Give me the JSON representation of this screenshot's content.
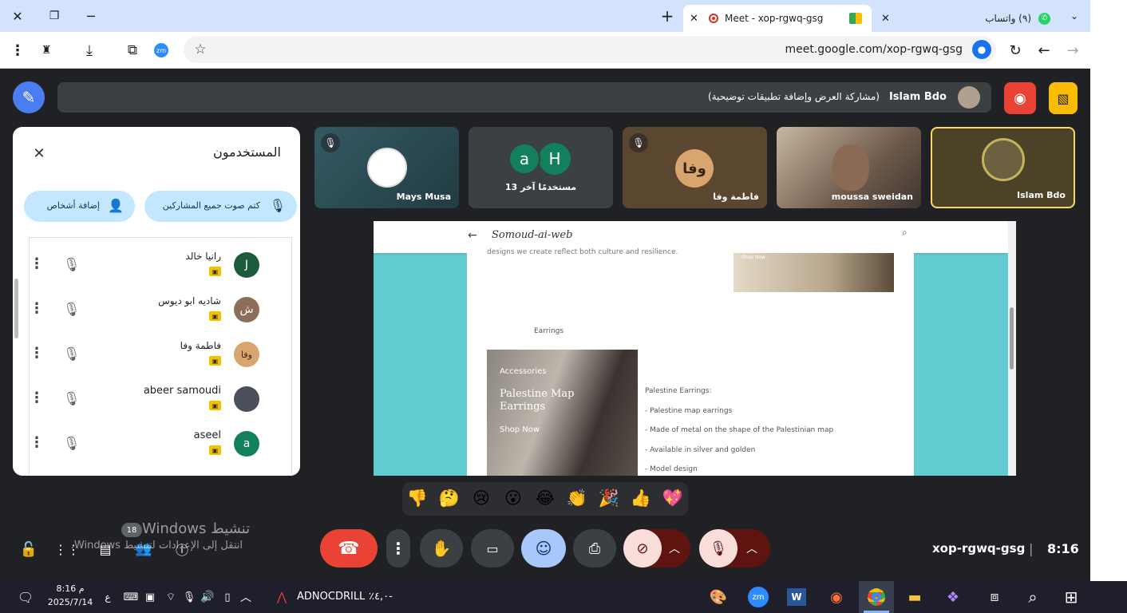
{
  "browser": {
    "tabs": [
      {
        "title": "Meet - xop-rgwq-gsg",
        "active": true
      },
      {
        "title": "(٩) واتساب",
        "active": false
      }
    ],
    "url": "meet.google.com/xop-rgwq-gsg"
  },
  "meet": {
    "presenter_bar": {
      "name": "Islam Bdo",
      "text": "(مشاركة العرض وإضافة تطبيقات توضيحية)"
    },
    "tiles": [
      {
        "name": "Islam Bdo",
        "muted": false,
        "highlight": true
      },
      {
        "name": "moussa sweidan",
        "muted": false
      },
      {
        "name": "فاطمة وفا",
        "muted": true,
        "avatar": "وفا"
      },
      {
        "name": "13 مستخدمًا آخر",
        "avatars": [
          "a",
          "H"
        ]
      },
      {
        "name": "Mays Musa",
        "muted": true
      }
    ],
    "panel": {
      "title": "المستخدمون",
      "mute_all": "كتم صوت جميع المشاركين",
      "add_people": "إضافة أشخاص",
      "participants": [
        {
          "name": "رانيا خالد",
          "initial": "J",
          "color": "#1e5a3c"
        },
        {
          "name": "شاديه ابو ديوس",
          "initial": "ش",
          "color": "#8d6e5a"
        },
        {
          "name": "فاطمة وفا",
          "initial": "وفا",
          "color": "#d9a56f"
        },
        {
          "name": "abeer samoudi",
          "initial": "",
          "color": "#4a4f59"
        },
        {
          "name": "aseel",
          "initial": "a",
          "color": "#12805c"
        }
      ]
    },
    "shared": {
      "site_title": "Somoud-ai-web",
      "snippet": "designs we create reflect both culture and resilience.",
      "shop_now_small": "Shop Now",
      "section": "Earrings",
      "img_tag": "Accessories",
      "img_title": "Palestine Map Earrings",
      "img_cta": "Shop Now",
      "details": [
        "Palestine Earrings:",
        "- Palestine map earrings",
        "- Made of metal on the shape of the Palestinian map",
        "- Available in silver and golden",
        "- Model design"
      ]
    },
    "reactions": [
      "👎",
      "🤔",
      "😢",
      "😮",
      "😂",
      "👏",
      "🎉",
      "👍",
      "💖"
    ],
    "meeting_code": "xop-rgwq-gsg",
    "time": "8:16",
    "participant_count": "18",
    "watermark": {
      "line1": "تنشيط Windows",
      "line2": "انتقل إلى الإعدادات لتنشيط Windows."
    }
  },
  "taskbar": {
    "time": "8:16 م",
    "date": "2025/7/14",
    "lang": "ع",
    "stock_name": "ADNOCDRILL",
    "stock_change": "-٤,٠٪"
  },
  "colors": {
    "accent": "#1a73e8",
    "end_call": "#ea4335",
    "panel_btn": "#c2e7ff",
    "tab_bg": "#d3e3fd"
  }
}
